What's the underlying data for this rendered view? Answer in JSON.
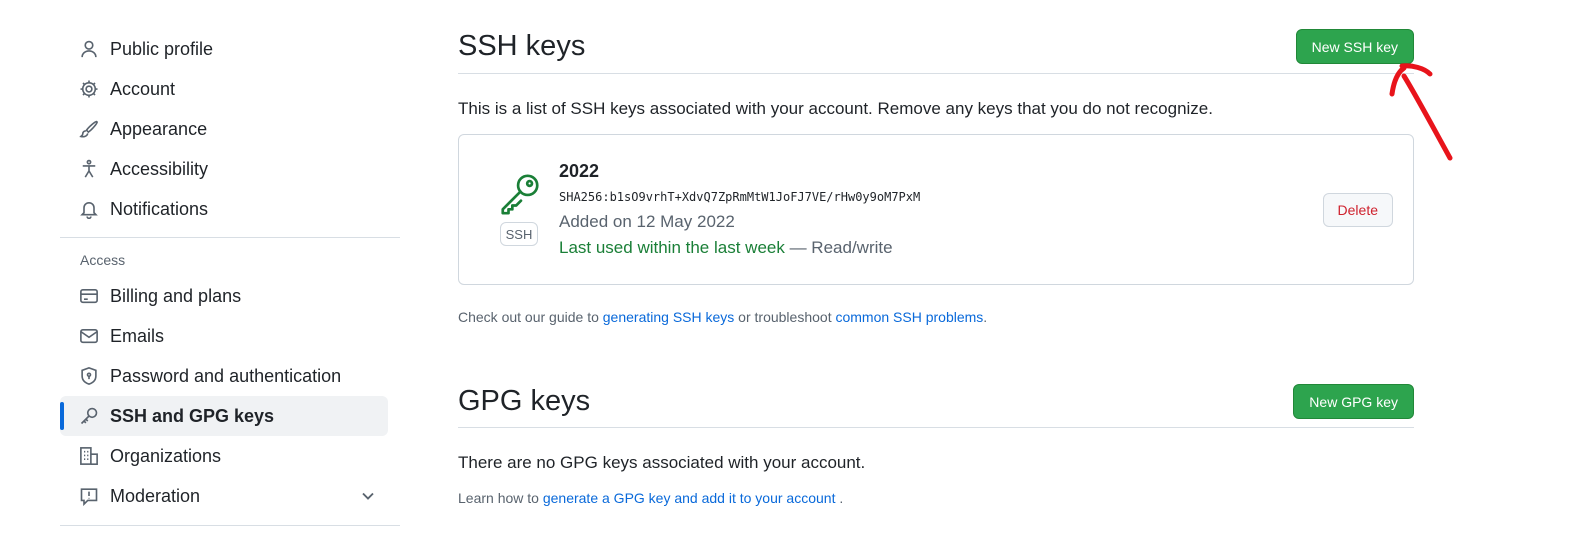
{
  "sidebar": {
    "top_items": [
      {
        "label": "Public profile",
        "icon": "person-icon"
      },
      {
        "label": "Account",
        "icon": "gear-icon"
      },
      {
        "label": "Appearance",
        "icon": "paintbrush-icon"
      },
      {
        "label": "Accessibility",
        "icon": "accessibility-icon"
      },
      {
        "label": "Notifications",
        "icon": "bell-icon"
      }
    ],
    "access_label": "Access",
    "access_items": [
      {
        "label": "Billing and plans",
        "icon": "credit-card-icon"
      },
      {
        "label": "Emails",
        "icon": "mail-icon"
      },
      {
        "label": "Password and authentication",
        "icon": "shield-lock-icon"
      },
      {
        "label": "SSH and GPG keys",
        "icon": "key-icon",
        "active": true
      },
      {
        "label": "Organizations",
        "icon": "organization-icon"
      },
      {
        "label": "Moderation",
        "icon": "report-icon"
      }
    ]
  },
  "ssh": {
    "title": "SSH keys",
    "new_button": "New SSH key",
    "description": "This is a list of SSH keys associated with your account. Remove any keys that you do not recognize.",
    "key": {
      "badge": "SSH",
      "title": "2022",
      "fingerprint": "SHA256:b1sO9vrhT+XdvQ7ZpRmMtW1JoFJ7VE/rHw0y9oM7PxM",
      "added": "Added on 12 May 2022",
      "last_used": "Last used within the last week",
      "access": " — Read/write",
      "delete_button": "Delete"
    },
    "guide_prefix": "Check out our guide to ",
    "guide_link1": "generating SSH keys",
    "guide_middle": " or troubleshoot ",
    "guide_link2": "common SSH problems",
    "guide_suffix": "."
  },
  "gpg": {
    "title": "GPG keys",
    "new_button": "New GPG key",
    "empty": "There are no GPG keys associated with your account.",
    "learn_prefix": "Learn how to ",
    "learn_link": "generate a GPG key and add it to your account",
    "learn_suffix": " ."
  },
  "colors": {
    "primary_button": "#2da44e",
    "link": "#0969da",
    "danger": "#cf222e",
    "success": "#1a7f37",
    "active_indicator": "#0969da",
    "annotation": "#e8141b"
  }
}
